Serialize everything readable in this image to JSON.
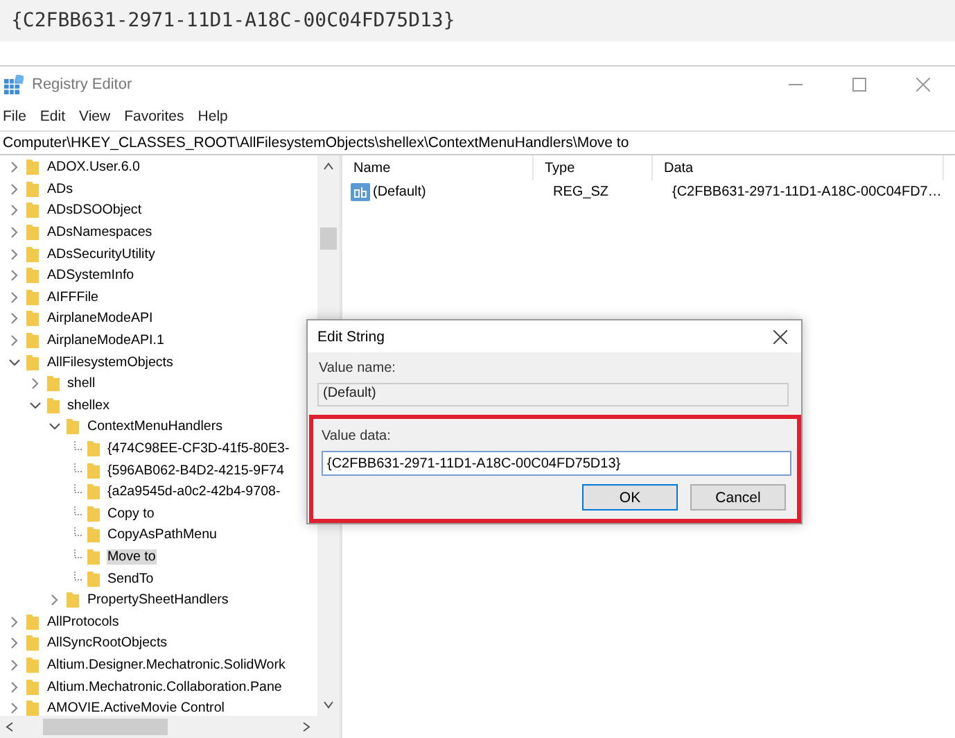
{
  "banner": {
    "text": "{C2FBB631-2971-11D1-A18C-00C04FD75D13}"
  },
  "window": {
    "title": "Registry Editor"
  },
  "menu": [
    "File",
    "Edit",
    "View",
    "Favorites",
    "Help"
  ],
  "address": "Computer\\HKEY_CLASSES_ROOT\\AllFilesystemObjects\\shellex\\ContextMenuHandlers\\Move to",
  "tree": [
    {
      "label": "ADOX.User.6.0",
      "kind": "node",
      "expanded": false,
      "selected": false
    },
    {
      "label": "ADs",
      "kind": "node",
      "expanded": false,
      "selected": false
    },
    {
      "label": "ADsDSOObject",
      "kind": "node",
      "expanded": false,
      "selected": false
    },
    {
      "label": "ADsNamespaces",
      "kind": "node",
      "expanded": false,
      "selected": false
    },
    {
      "label": "ADsSecurityUtility",
      "kind": "node",
      "expanded": false,
      "selected": false
    },
    {
      "label": "ADSystemInfo",
      "kind": "node",
      "expanded": false,
      "selected": false
    },
    {
      "label": "AIFFFile",
      "kind": "node",
      "expanded": false,
      "selected": false
    },
    {
      "label": "AirplaneModeAPI",
      "kind": "node",
      "expanded": false,
      "selected": false
    },
    {
      "label": "AirplaneModeAPI.1",
      "kind": "node",
      "expanded": false,
      "selected": false
    },
    {
      "label": "AllFilesystemObjects",
      "kind": "node",
      "expanded": true,
      "selected": false,
      "children": [
        {
          "label": "shell",
          "kind": "node",
          "expanded": false,
          "selected": false
        },
        {
          "label": "shellex",
          "kind": "node",
          "expanded": true,
          "selected": false,
          "children": [
            {
              "label": "ContextMenuHandlers",
              "kind": "node",
              "expanded": true,
              "selected": false,
              "children": [
                {
                  "label": "{474C98EE-CF3D-41f5-80E3-",
                  "kind": "leaf",
                  "selected": false
                },
                {
                  "label": "{596AB062-B4D2-4215-9F74",
                  "kind": "leaf",
                  "selected": false
                },
                {
                  "label": "{a2a9545d-a0c2-42b4-9708-",
                  "kind": "leaf",
                  "selected": false
                },
                {
                  "label": "Copy to",
                  "kind": "leaf",
                  "selected": false
                },
                {
                  "label": "CopyAsPathMenu",
                  "kind": "leaf",
                  "selected": false
                },
                {
                  "label": "Move to",
                  "kind": "leaf",
                  "selected": true
                },
                {
                  "label": "SendTo",
                  "kind": "leaf",
                  "selected": false
                }
              ]
            },
            {
              "label": "PropertySheetHandlers",
              "kind": "node",
              "expanded": false,
              "selected": false
            }
          ]
        }
      ]
    },
    {
      "label": "AllProtocols",
      "kind": "node",
      "expanded": false,
      "selected": false
    },
    {
      "label": "AllSyncRootObjects",
      "kind": "node",
      "expanded": false,
      "selected": false
    },
    {
      "label": "Altium.Designer.Mechatronic.SolidWork",
      "kind": "node",
      "expanded": false,
      "selected": false
    },
    {
      "label": "Altium.Mechatronic.Collaboration.Pane",
      "kind": "node",
      "expanded": false,
      "selected": false
    },
    {
      "label": "AMOVIE.ActiveMovie Control",
      "kind": "node",
      "expanded": false,
      "selected": false
    }
  ],
  "values": {
    "columns": [
      "Name",
      "Type",
      "Data"
    ],
    "rows": [
      {
        "name": "(Default)",
        "type": "REG_SZ",
        "data": "{C2FBB631-2971-11D1-A18C-00C04FD7…"
      }
    ]
  },
  "dialog": {
    "title": "Edit String",
    "value_name_label": "Value name:",
    "value_name": "(Default)",
    "value_data_label": "Value data:",
    "value_data": "{C2FBB631-2971-11D1-A18C-00C04FD75D13}",
    "buttons": [
      "OK",
      "Cancel"
    ],
    "highlighted": true
  }
}
